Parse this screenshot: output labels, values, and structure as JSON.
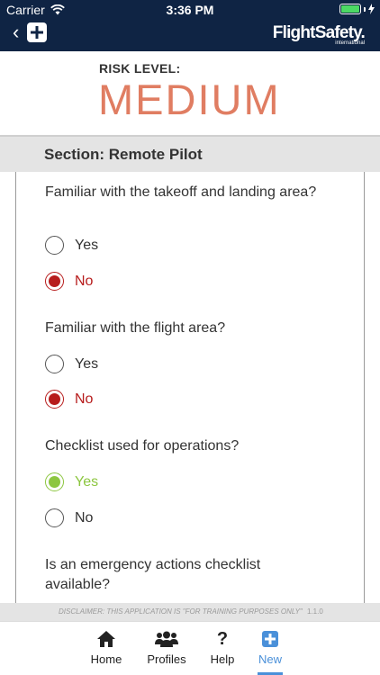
{
  "status": {
    "carrier": "Carrier",
    "time": "3:36 PM"
  },
  "nav": {
    "back_label": "‹",
    "brand": "FlightSafety.",
    "brand_sub": "international"
  },
  "risk": {
    "label": "RISK LEVEL:",
    "value": "MEDIUM",
    "color": "#e07d62"
  },
  "section": {
    "title": "Section: Remote Pilot"
  },
  "questions": [
    {
      "text": "Familiar with the takeoff and landing area?",
      "options": [
        "Yes",
        "No"
      ],
      "selected": "No"
    },
    {
      "text": "Familiar with the flight area?",
      "options": [
        "Yes",
        "No"
      ],
      "selected": "No"
    },
    {
      "text": "Checklist used for operations?",
      "options": [
        "Yes",
        "No"
      ],
      "selected": "Yes"
    },
    {
      "text": "Is an emergency actions checklist available?"
    }
  ],
  "disclaimer": {
    "text": "DISCLAIMER: THIS APPLICATION IS \"FOR TRAINING PURPOSES ONLY\"",
    "version": "1.1.0"
  },
  "tabs": [
    {
      "label": "Home",
      "icon": "home-icon"
    },
    {
      "label": "Profiles",
      "icon": "profiles-icon"
    },
    {
      "label": "Help",
      "icon": "help-icon"
    },
    {
      "label": "New",
      "icon": "new-icon",
      "active": true
    }
  ],
  "colors": {
    "navbar": "#0f2444",
    "selected_no": "#b71c1c",
    "selected_yes": "#8cc63f",
    "active_tab": "#4a90d9"
  }
}
